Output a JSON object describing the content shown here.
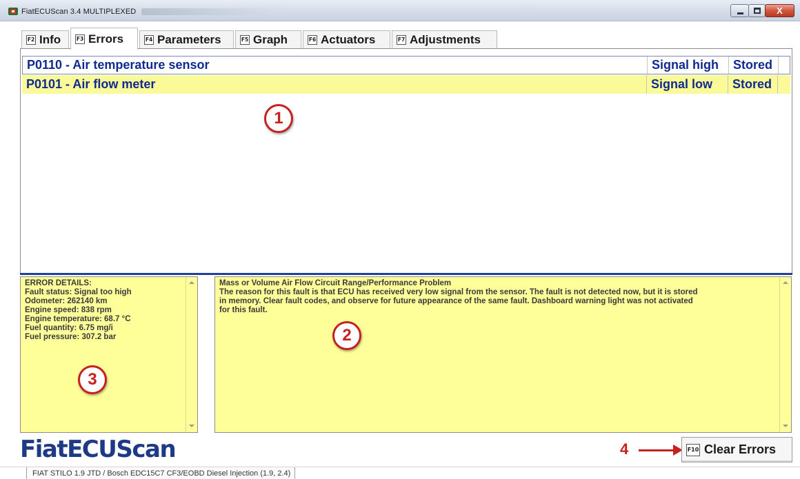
{
  "window": {
    "title": "FiatECUScan 3.4 MULTIPLEXED",
    "close_label": "X"
  },
  "tabs": [
    {
      "key": "F2",
      "label": "Info"
    },
    {
      "key": "F3",
      "label": "Errors"
    },
    {
      "key": "F4",
      "label": "Parameters"
    },
    {
      "key": "F5",
      "label": "Graph"
    },
    {
      "key": "F6",
      "label": "Actuators"
    },
    {
      "key": "F7",
      "label": "Adjustments"
    }
  ],
  "active_tab": "Errors",
  "errors": [
    {
      "code": "P0110 - Air temperature sensor",
      "signal": "Signal high",
      "status": "Stored"
    },
    {
      "code": "P0101 - Air flow meter",
      "signal": "Signal low",
      "status": "Stored"
    }
  ],
  "error_details": [
    "ERROR DETAILS:",
    "Fault status: Signal too high",
    "Odometer: 262140 km",
    "Engine speed: 838 rpm",
    "Engine temperature: 68.7 °C",
    "Fuel quantity: 6.75 mg/i",
    "Fuel pressure: 307.2 bar"
  ],
  "description": {
    "title": "Mass or Volume Air Flow Circuit Range/Performance Problem",
    "lines": [
      "The reason for this fault is that ECU has received very low signal from the sensor. The fault is not detected now, but it is stored",
      "in memory. Clear fault codes, and observe for future appearance of the same fault. Dashboard warning light was not activated",
      "for this fault."
    ]
  },
  "annotations": {
    "n1": "1",
    "n2": "2",
    "n3": "3",
    "n4": "4"
  },
  "footer": {
    "logo": "FiatECUScan",
    "clear_key": "F10",
    "clear_label": "Clear Errors",
    "status": "FIAT STILO 1.9 JTD / Bosch EDC15C7 CF3/EOBD Diesel Injection (1.9, 2.4)"
  },
  "colors": {
    "error_text": "#102a8f",
    "selected_row": "#fafa99",
    "panel_yellow": "#ffff99",
    "annotation_red": "#c8201f",
    "logo_blue": "#1e3a87"
  }
}
